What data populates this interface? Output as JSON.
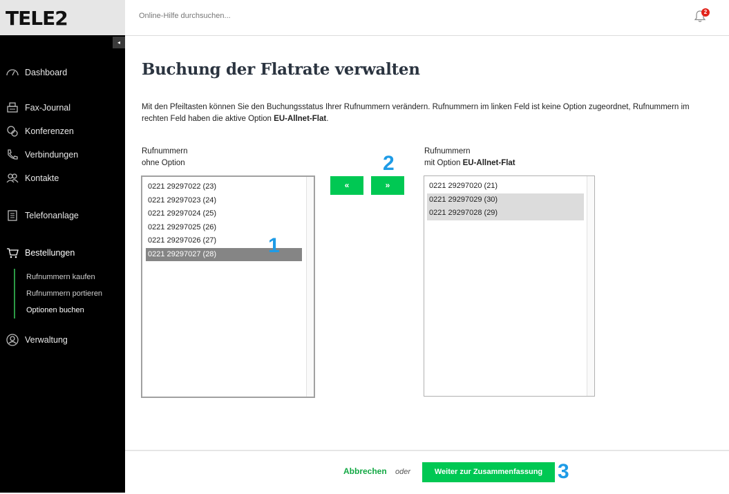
{
  "brand": {
    "logo": "TELE2"
  },
  "header": {
    "search_placeholder": "Online-Hilfe durchsuchen...",
    "notification_count": "2"
  },
  "sidebar": {
    "collapse_glyph": "◂",
    "items": [
      {
        "label": "Dashboard",
        "icon": "dashboard-icon"
      },
      {
        "label": "Fax-Journal",
        "icon": "fax-icon"
      },
      {
        "label": "Konferenzen",
        "icon": "conference-icon"
      },
      {
        "label": "Verbindungen",
        "icon": "phone-icon"
      },
      {
        "label": "Kontakte",
        "icon": "contacts-icon"
      },
      {
        "label": "Telefonanlage",
        "icon": "pbx-icon"
      },
      {
        "label": "Bestellungen",
        "icon": "cart-icon"
      },
      {
        "label": "Verwaltung",
        "icon": "user-icon"
      }
    ],
    "subitems": [
      {
        "label": "Rufnummern kaufen"
      },
      {
        "label": "Rufnummern portieren"
      },
      {
        "label": "Optionen buchen"
      }
    ]
  },
  "main": {
    "title": "Buchung der Flatrate verwalten",
    "description_1": "Mit den Pfeiltasten können Sie den Buchungsstatus Ihrer Rufnummern verändern. Rufnummern im linken Feld ist keine Option zugeordnet, Rufnummern im rechten Feld haben die aktive Option ",
    "description_bold": "EU-Allnet-Flat",
    "description_2": ".",
    "left_label_1": "Rufnummern",
    "left_label_2": "ohne Option",
    "right_label_1": "Rufnummern",
    "right_label_2_prefix": "mit Option ",
    "right_label_2_bold": "EU-Allnet-Flat",
    "left_list": [
      {
        "text": "0221 29297022 (23)",
        "selected": false
      },
      {
        "text": "0221 29297023 (24)",
        "selected": false
      },
      {
        "text": "0221 29297024 (25)",
        "selected": false
      },
      {
        "text": "0221 29297025 (26)",
        "selected": false
      },
      {
        "text": "0221 29297026 (27)",
        "selected": false
      },
      {
        "text": "0221 29297027 (28)",
        "selected": true
      }
    ],
    "right_list": [
      {
        "text": "0221 29297020 (21)",
        "selected": false
      },
      {
        "text": "0221 29297029 (30)",
        "selected": true
      },
      {
        "text": "0221 29297028 (29)",
        "selected": true
      }
    ],
    "move_left_label": "«",
    "move_right_label": "»",
    "markers": [
      "1",
      "2",
      "3"
    ]
  },
  "footer": {
    "cancel_label": "Abbrechen",
    "or_label": "oder",
    "next_label": "Weiter zur Zusammenfassung"
  },
  "colors": {
    "accent_green": "#00c853",
    "link_green": "#12a843",
    "badge_red": "#e2231a",
    "marker_blue": "#1e9be6",
    "sidebar_bg": "#000000"
  }
}
